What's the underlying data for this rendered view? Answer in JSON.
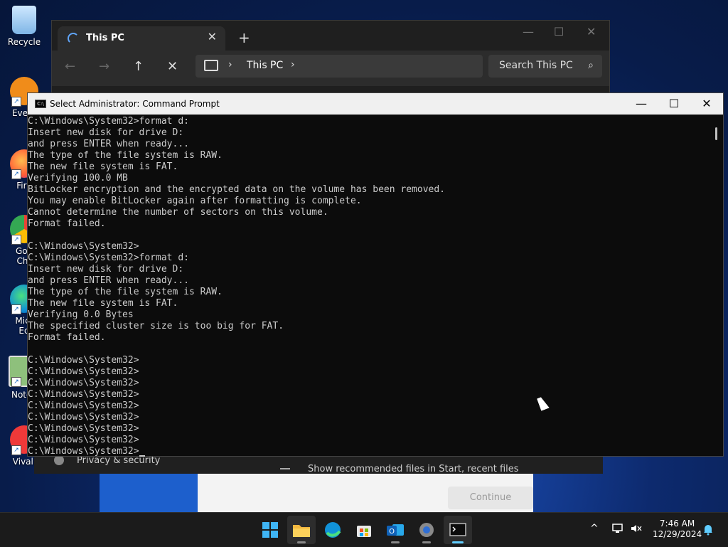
{
  "desktop": {
    "icons": [
      {
        "label": "Recycle",
        "name": "recycle-bin-icon"
      },
      {
        "label": "Every",
        "name": "everything-icon"
      },
      {
        "label": "Fire",
        "name": "firefox-icon"
      },
      {
        "label": "Goo Chr",
        "name": "google-chrome-icon"
      },
      {
        "label": "Micr Ed",
        "name": "microsoft-edge-icon"
      },
      {
        "label": "Notep",
        "name": "notepad-icon"
      },
      {
        "label": "Vivali",
        "name": "vivaldi-icon"
      }
    ]
  },
  "background_window": {
    "privacy_label": "Privacy & security",
    "recommended_label": "Show recommended files in Start, recent files",
    "continue_label": "Continue"
  },
  "explorer": {
    "tab_title": "This PC",
    "tab_close": "✕",
    "new_tab": "+",
    "minimize": "—",
    "maximize": "☐",
    "close": "✕",
    "nav_back": "←",
    "nav_forward": "→",
    "nav_up": "↑",
    "nav_stop": "✕",
    "breadcrumb_chevron": "›",
    "location": "This PC",
    "search_placeholder": "Search This PC",
    "search_icon": "⌕"
  },
  "cmd": {
    "title": "Select Administrator: Command Prompt",
    "icon_text": "C:\\",
    "minimize": "—",
    "maximize": "☐",
    "close": "✕",
    "output": "C:\\Windows\\System32>format d:\nInsert new disk for drive D:\nand press ENTER when ready...\nThe type of the file system is RAW.\nThe new file system is FAT.\nVerifying 100.0 MB\nBitLocker encryption and the encrypted data on the volume has been removed.\nYou may enable BitLocker again after formatting is complete.\nCannot determine the number of sectors on this volume.\nFormat failed.\n\nC:\\Windows\\System32>\nC:\\Windows\\System32>format d:\nInsert new disk for drive D:\nand press ENTER when ready...\nThe type of the file system is RAW.\nThe new file system is FAT.\nVerifying 0.0 Bytes\nThe specified cluster size is too big for FAT.\nFormat failed.\n\nC:\\Windows\\System32>\nC:\\Windows\\System32>\nC:\\Windows\\System32>\nC:\\Windows\\System32>\nC:\\Windows\\System32>\nC:\\Windows\\System32>\nC:\\Windows\\System32>\nC:\\Windows\\System32>\nC:\\Windows\\System32>"
  },
  "taskbar": {
    "apps": [
      {
        "name": "start-button",
        "icon": "windows-logo-icon"
      },
      {
        "name": "file-explorer",
        "icon": "folder-icon"
      },
      {
        "name": "edge",
        "icon": "edge-icon"
      },
      {
        "name": "store",
        "icon": "store-icon"
      },
      {
        "name": "outlook",
        "icon": "outlook-icon"
      },
      {
        "name": "settings",
        "icon": "gear-icon"
      },
      {
        "name": "terminal",
        "icon": "terminal-icon"
      }
    ],
    "tray_chevron": "^",
    "time": "7:46 AM",
    "date": "12/29/2024"
  },
  "colors": {
    "accent": "#60cdff",
    "console_bg": "#0c0c0c",
    "console_text": "#cccccc"
  }
}
